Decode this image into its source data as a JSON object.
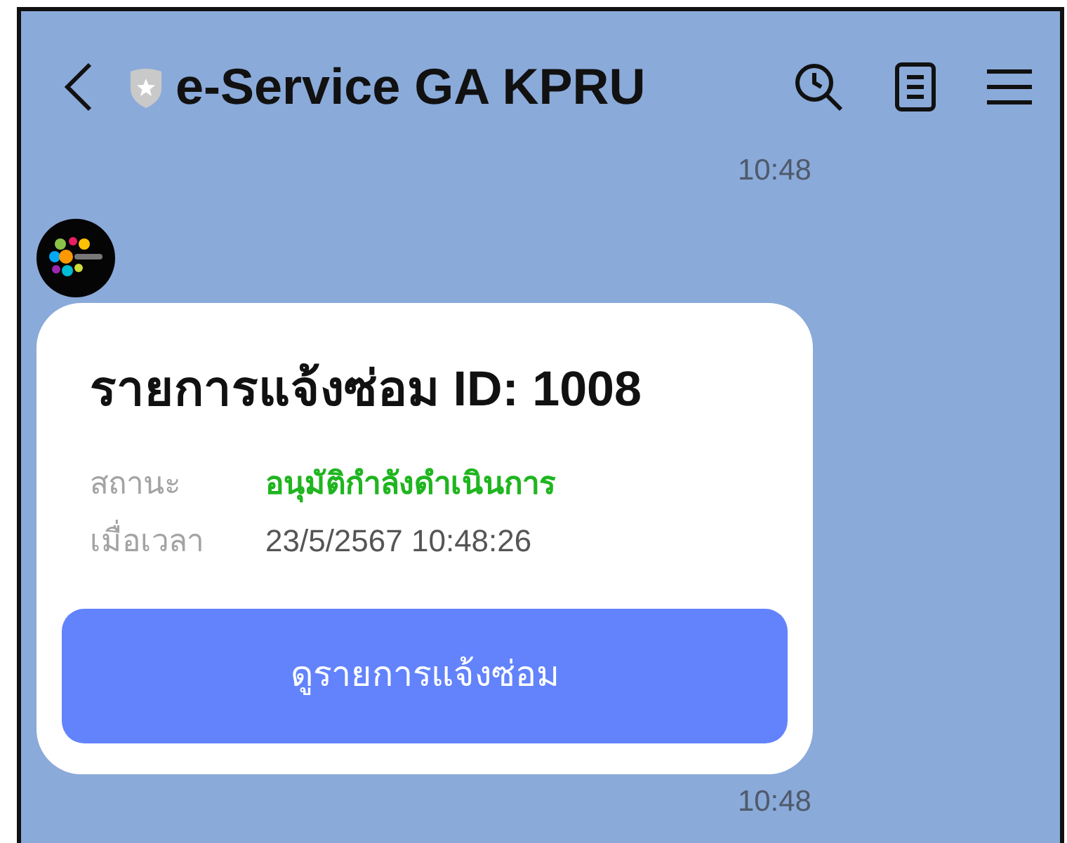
{
  "header": {
    "title": "e-Service GA KPRU"
  },
  "messages": [
    {
      "kind": "time",
      "text": "10:48"
    },
    {
      "kind": "card",
      "title": "รายการแจ้งซ่อม ID: 1008",
      "fields": [
        {
          "label": "สถานะ",
          "value": "อนุมัติกำลังดำเนินการ",
          "kind": "status"
        },
        {
          "label": "เมื่อเวลา",
          "value": "23/5/2567 10:48:26",
          "kind": "text"
        }
      ],
      "button": "ดูรายการแจ้งซ่อม"
    },
    {
      "kind": "time",
      "text": "10:48"
    }
  ]
}
